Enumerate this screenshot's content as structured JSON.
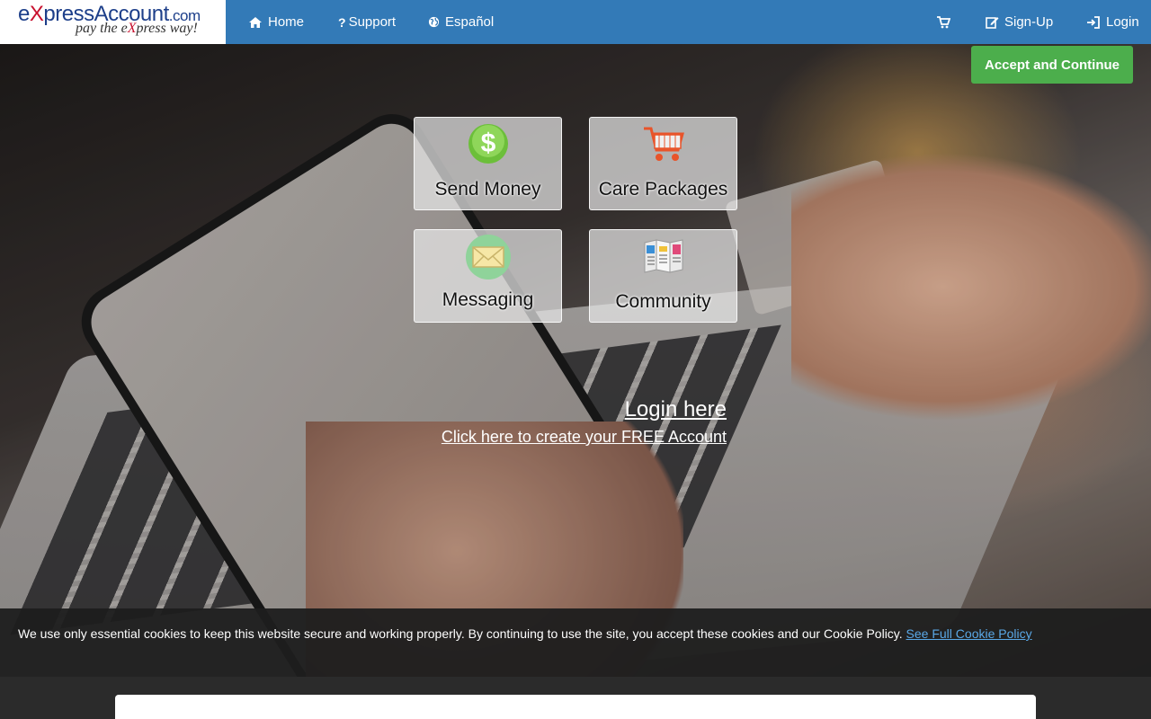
{
  "brand": {
    "name_prefix": "e",
    "name_x": "X",
    "name_rest": "pressAccount",
    "name_domain": ".com",
    "tagline_pre": "pay the e",
    "tagline_x": "X",
    "tagline_post": "press way!"
  },
  "nav": {
    "home": "Home",
    "support": "Support",
    "language": "Español",
    "signup": "Sign-Up",
    "login": "Login"
  },
  "tiles": [
    {
      "label": "Send Money",
      "icon": "dollar-icon"
    },
    {
      "label": "Care Packages",
      "icon": "cart-icon"
    },
    {
      "label": "Messaging",
      "icon": "envelope-icon"
    },
    {
      "label": "Community",
      "icon": "brochure-icon"
    }
  ],
  "links": {
    "login_here": "Login here",
    "create_account": "Click here to create your FREE Account"
  },
  "cookie": {
    "text": "We use only essential cookies to keep this website secure and working properly. By continuing to use the site, you accept these cookies and our Cookie Policy.",
    "policy_link": "See Full Cookie Policy",
    "accept_button": "Accept and Continue"
  },
  "colors": {
    "nav_bg": "#337ab7",
    "accept_bg": "#4cae4c",
    "link_blue": "#5aa8e6"
  }
}
